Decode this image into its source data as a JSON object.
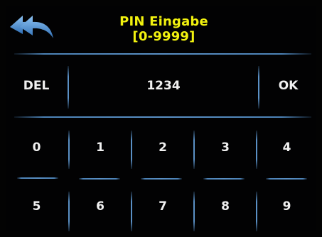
{
  "header": {
    "back_icon": "back-arrow-icon",
    "title_line1": "PIN Eingabe",
    "title_line2": "[0-9999]"
  },
  "entry": {
    "del_label": "DEL",
    "value": "1234",
    "ok_label": "OK"
  },
  "keypad": {
    "row1": [
      "0",
      "1",
      "2",
      "3",
      "4"
    ],
    "row2": [
      "5",
      "6",
      "7",
      "8",
      "9"
    ]
  },
  "colors": {
    "title": "#f2f20f",
    "text": "#f0f0f0",
    "divider": "#5a90c5",
    "back_icon": "#4d8fd6",
    "background": "#020203"
  }
}
